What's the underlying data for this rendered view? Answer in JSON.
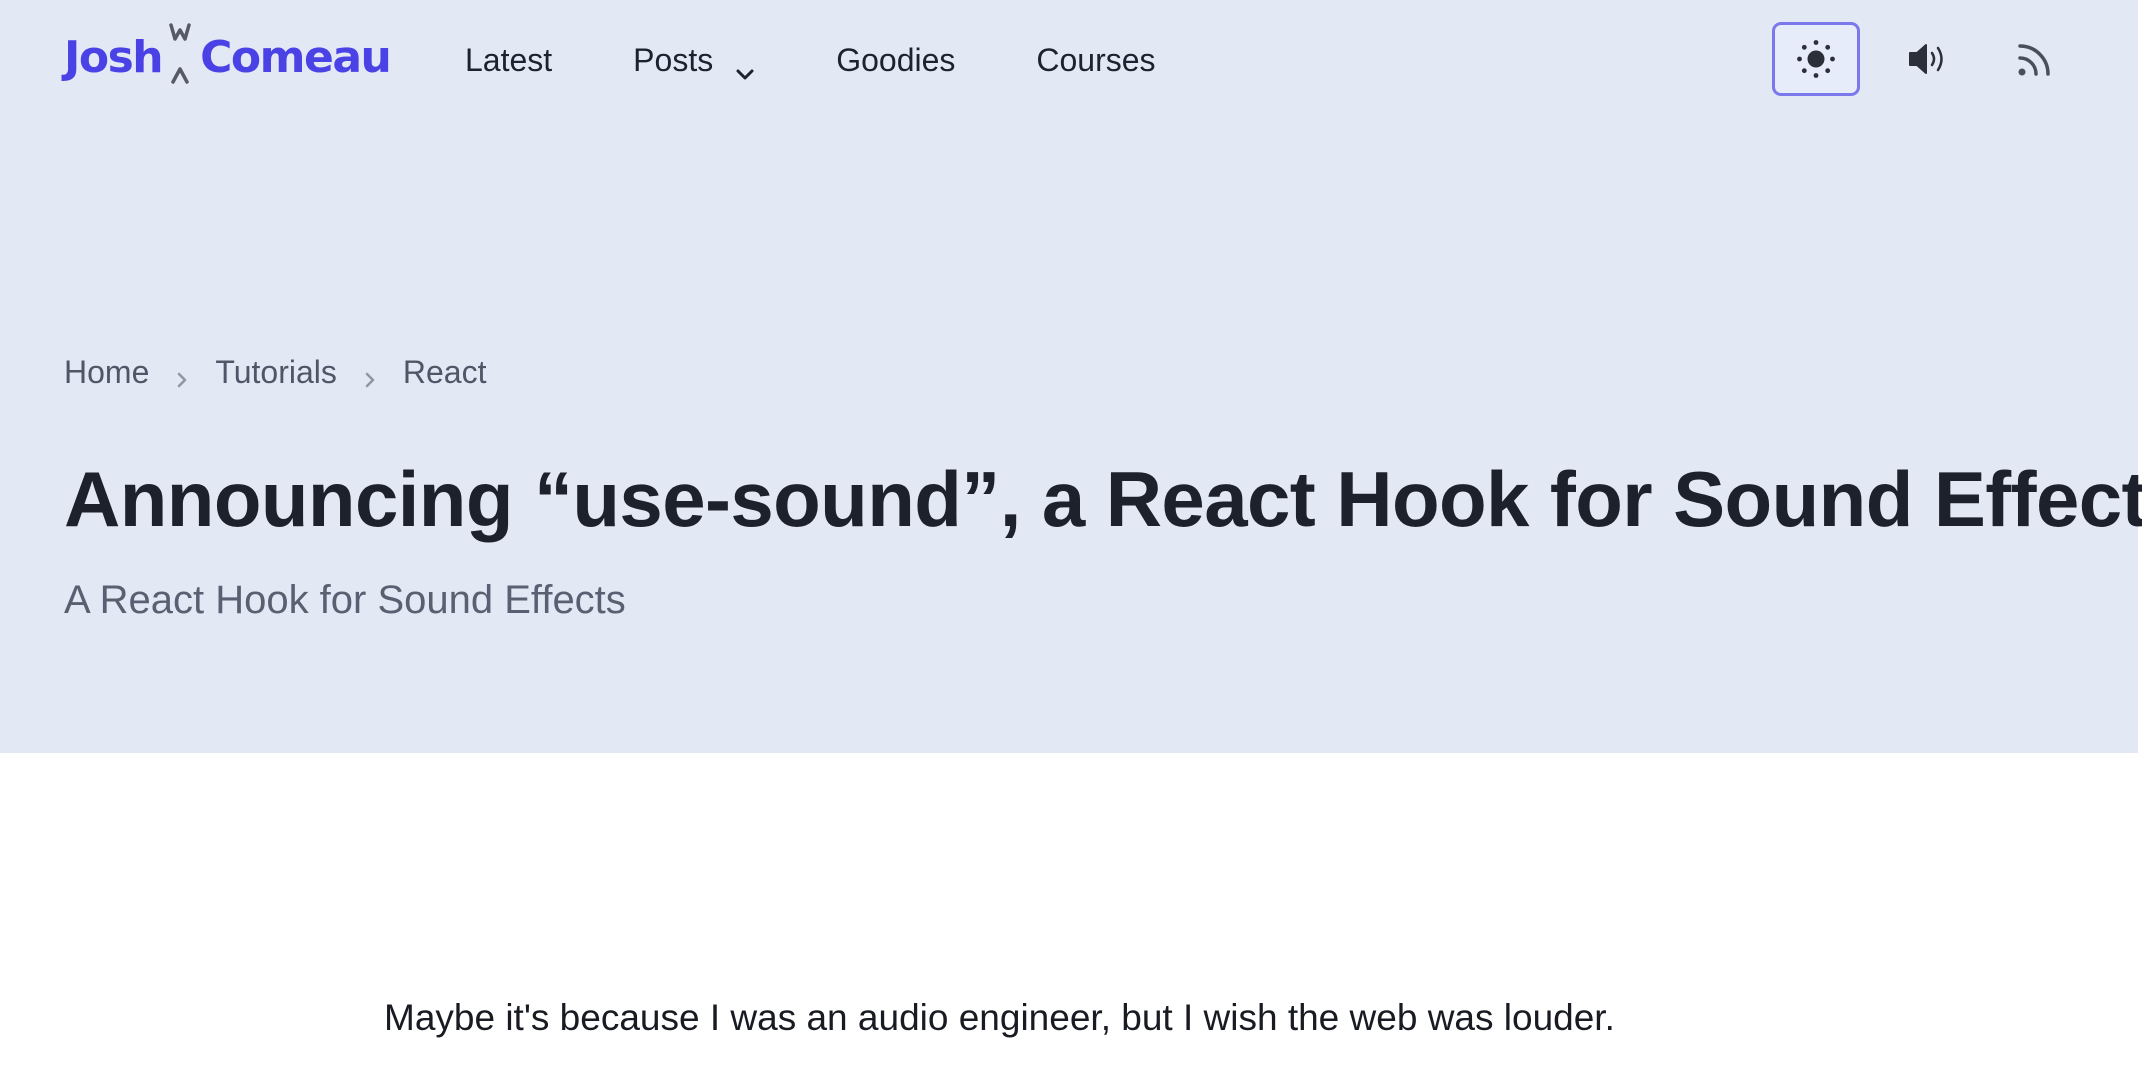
{
  "header": {
    "logo": {
      "first": "Josh",
      "second": "Comeau"
    },
    "nav": [
      {
        "label": "Latest"
      },
      {
        "label": "Posts",
        "has_dropdown": true
      },
      {
        "label": "Goodies"
      },
      {
        "label": "Courses"
      }
    ],
    "actions": [
      {
        "icon": "sun-icon",
        "state": "active"
      },
      {
        "icon": "speaker-icon"
      },
      {
        "icon": "rss-icon"
      }
    ]
  },
  "breadcrumb": {
    "items": [
      "Home",
      "Tutorials",
      "React"
    ]
  },
  "post": {
    "title": "Announcing “use-sound”, a React Hook for Sound Effects",
    "subtitle": "A React Hook for Sound Effects",
    "intro": "Maybe it's because I was an audio engineer, but I wish the web was louder."
  },
  "colors": {
    "brand": "#4b42e6",
    "hero_bg": "#e2e9f4",
    "active_border": "#7b78ec"
  }
}
